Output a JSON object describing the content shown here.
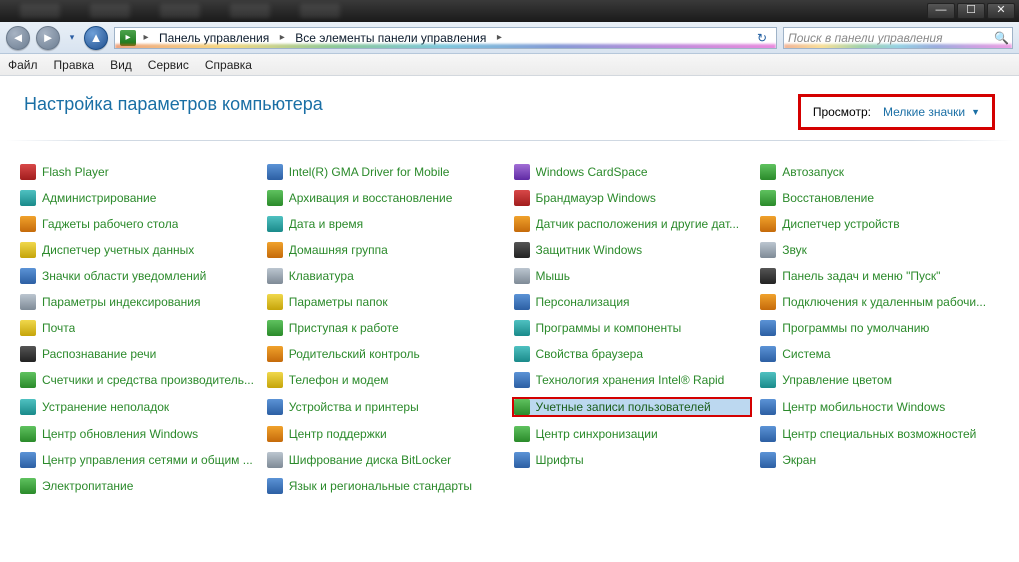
{
  "window": {
    "minimize": "—",
    "maximize": "☐",
    "close": "✕"
  },
  "nav": {
    "back": "◄",
    "forward": "►",
    "recent": "▾",
    "refresh": "↻"
  },
  "breadcrumb": {
    "root_glyph": "▸",
    "segments": [
      "Панель управления",
      "Все элементы панели управления"
    ],
    "chev": "▸"
  },
  "search": {
    "placeholder": "Поиск в панели управления",
    "icon": "🔍"
  },
  "menu": [
    "Файл",
    "Правка",
    "Вид",
    "Сервис",
    "Справка"
  ],
  "header": {
    "title": "Настройка параметров компьютера",
    "view_label": "Просмотр:",
    "view_value": "Мелкие значки",
    "view_chev": "▼"
  },
  "items": [
    {
      "label": "Flash Player",
      "cls": "red"
    },
    {
      "label": "Администрирование",
      "cls": "teal"
    },
    {
      "label": "Гаджеты рабочего стола",
      "cls": "orange"
    },
    {
      "label": "Диспетчер учетных данных",
      "cls": "yellow"
    },
    {
      "label": "Значки области уведомлений",
      "cls": ""
    },
    {
      "label": "Параметры индексирования",
      "cls": "gray"
    },
    {
      "label": "Почта",
      "cls": "yellow"
    },
    {
      "label": "Распознавание речи",
      "cls": "dark"
    },
    {
      "label": "Счетчики и средства производитель...",
      "cls": "green"
    },
    {
      "label": "Устранение неполадок",
      "cls": "teal"
    },
    {
      "label": "Центр обновления Windows",
      "cls": "green"
    },
    {
      "label": "Центр управления сетями и общим ...",
      "cls": ""
    },
    {
      "label": "Электропитание",
      "cls": "green"
    },
    {
      "label": "Intel(R) GMA Driver for Mobile",
      "cls": ""
    },
    {
      "label": "Архивация и восстановление",
      "cls": "green"
    },
    {
      "label": "Дата и время",
      "cls": "teal"
    },
    {
      "label": "Домашняя группа",
      "cls": "orange"
    },
    {
      "label": "Клавиатура",
      "cls": "gray"
    },
    {
      "label": "Параметры папок",
      "cls": "yellow"
    },
    {
      "label": "Приступая к работе",
      "cls": "green"
    },
    {
      "label": "Родительский контроль",
      "cls": "orange"
    },
    {
      "label": "Телефон и модем",
      "cls": "yellow"
    },
    {
      "label": "Устройства и принтеры",
      "cls": ""
    },
    {
      "label": "Центр поддержки",
      "cls": "orange"
    },
    {
      "label": "Шифрование диска BitLocker",
      "cls": "gray"
    },
    {
      "label": "Язык и региональные стандарты",
      "cls": ""
    },
    {
      "label": "Windows CardSpace",
      "cls": "purple"
    },
    {
      "label": "Брандмауэр Windows",
      "cls": "red"
    },
    {
      "label": "Датчик расположения и другие дат...",
      "cls": "orange"
    },
    {
      "label": "Защитник Windows",
      "cls": "dark"
    },
    {
      "label": "Мышь",
      "cls": "gray"
    },
    {
      "label": "Персонализация",
      "cls": ""
    },
    {
      "label": "Программы и компоненты",
      "cls": "teal"
    },
    {
      "label": "Свойства браузера",
      "cls": "teal"
    },
    {
      "label": "Технология хранения Intel® Rapid",
      "cls": ""
    },
    {
      "label": "Учетные записи пользователей",
      "cls": "green",
      "selected": true
    },
    {
      "label": "Центр синхронизации",
      "cls": "green"
    },
    {
      "label": "Шрифты",
      "cls": ""
    },
    {
      "label": "Автозапуск",
      "cls": "green"
    },
    {
      "label": "Восстановление",
      "cls": "green"
    },
    {
      "label": "Диспетчер устройств",
      "cls": "orange"
    },
    {
      "label": "Звук",
      "cls": "gray"
    },
    {
      "label": "Панель задач и меню \"Пуск\"",
      "cls": "dark"
    },
    {
      "label": "Подключения к удаленным рабочи...",
      "cls": "orange"
    },
    {
      "label": "Программы по умолчанию",
      "cls": ""
    },
    {
      "label": "Система",
      "cls": ""
    },
    {
      "label": "Управление цветом",
      "cls": "teal"
    },
    {
      "label": "Центр мобильности Windows",
      "cls": ""
    },
    {
      "label": "Центр специальных возможностей",
      "cls": ""
    },
    {
      "label": "Экран",
      "cls": ""
    }
  ]
}
